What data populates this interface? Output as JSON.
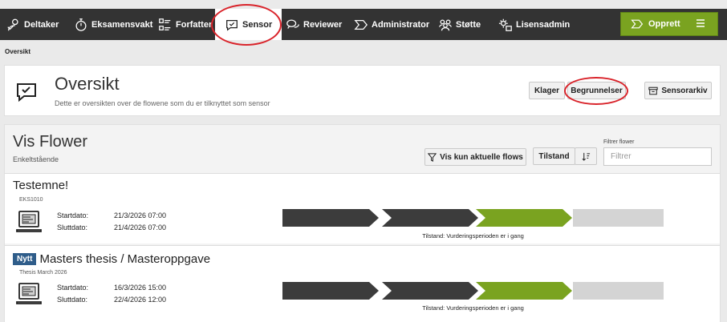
{
  "nav": {
    "items": [
      {
        "label": "Deltaker",
        "icon": "participant-icon"
      },
      {
        "label": "Eksamensvakt",
        "icon": "stopwatch-icon"
      },
      {
        "label": "Forfatter",
        "icon": "checklist-icon"
      },
      {
        "label": "Sensor",
        "icon": "speech-check-icon"
      },
      {
        "label": "Reviewer",
        "icon": "speech-bubbles-icon"
      },
      {
        "label": "Administrator",
        "icon": "flow-icon"
      },
      {
        "label": "Støtte",
        "icon": "people-icon"
      },
      {
        "label": "Lisensadmin",
        "icon": "puzzle-gear-icon"
      }
    ],
    "active": "Sensor",
    "create_label": "Opprett",
    "create_menu_icon": "hamburger-icon"
  },
  "breadcrumb": "Oversikt",
  "header": {
    "title": "Oversikt",
    "subtitle": "Dette er oversikten over de flowene som du er tilknyttet som sensor",
    "buttons": {
      "klager": "Klager",
      "begrunnelser": "Begrunnelser",
      "sensorarkiv": "Sensorarkiv"
    }
  },
  "flows_panel": {
    "title": "Vis Flower",
    "subtitle": "Enkeltstående",
    "filter_current_label": "Vis kun aktuelle flows",
    "sort_label": "Tilstand",
    "filter_label": "Filtrer flower",
    "filter_placeholder": "Filtrer"
  },
  "flows": [
    {
      "title": "Testemne!",
      "code": "EKS1010",
      "is_new": false,
      "start_label": "Startdato:",
      "start": "21/3/2026 07:00",
      "end_label": "Sluttdato:",
      "end": "21/4/2026 07:00",
      "state": "Tilstand: Vurderingsperioden er i gang",
      "phases": [
        "done",
        "done",
        "active",
        "pending"
      ]
    },
    {
      "title": "Masters thesis / Masteroppgave",
      "code": "Thesis March 2026",
      "is_new": true,
      "new_label": "Nytt",
      "start_label": "Startdato:",
      "start": "16/3/2026 15:00",
      "end_label": "Sluttdato:",
      "end": "22/4/2026 12:00",
      "state": "Tilstand: Vurderingsperioden er i gang",
      "phases": [
        "done",
        "done",
        "active",
        "pending"
      ]
    }
  ],
  "colors": {
    "navbar": "#333333",
    "accent_green": "#7aa320",
    "phase_done": "#3c3c3c",
    "phase_active": "#7aa320",
    "phase_pending": "#d4d4d4",
    "badge_new": "#2f5d8a",
    "annotation_red": "#d9242b"
  }
}
